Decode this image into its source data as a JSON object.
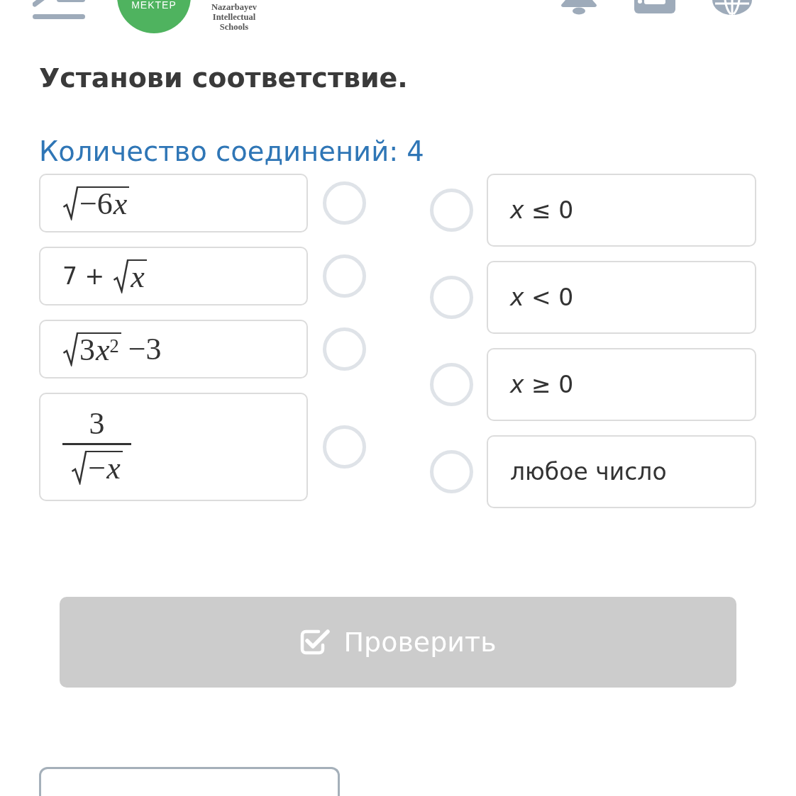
{
  "header": {
    "logo_text": "MEKTEP",
    "school_name": [
      "Nazarbayev",
      "Intellectual",
      "Schools"
    ]
  },
  "task": {
    "title": "Установи соответствие.",
    "connections_label": "Количество соединений: 4"
  },
  "left_items": [
    {
      "kind": "root",
      "radicand": {
        "coefficient": "−6",
        "variable": "x"
      }
    },
    {
      "kind": "root",
      "prefix": "7 +",
      "radicand": {
        "variable": "x"
      }
    },
    {
      "kind": "root",
      "radicand": {
        "coefficient": "3",
        "variable": "x",
        "exponent": "2"
      },
      "suffix": "−3"
    },
    {
      "kind": "fraction",
      "numerator": "3",
      "radicand": {
        "coefficient": "−",
        "variable": "x"
      }
    }
  ],
  "right_items": [
    {
      "text": "*x* ≤ 0"
    },
    {
      "text": "*x* < 0"
    },
    {
      "text": "*x* ≥ 0"
    },
    {
      "text": "любое число"
    }
  ],
  "check_button": {
    "label": "Проверить",
    "disabled": true
  }
}
